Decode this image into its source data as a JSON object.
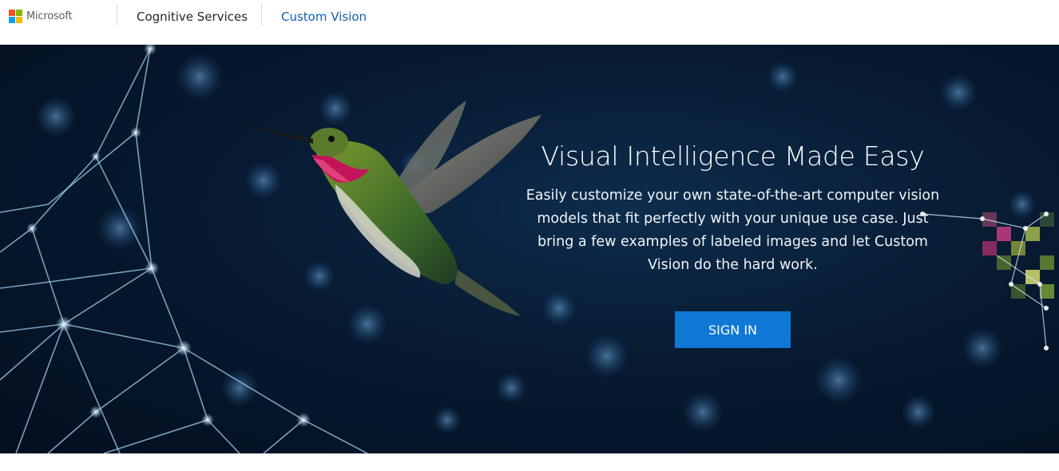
{
  "header": {
    "brand": "Microsoft",
    "brand_colors": [
      "#f25022",
      "#7fba00",
      "#00a4ef",
      "#ffb900"
    ],
    "nav": [
      {
        "label": "Cognitive Services"
      },
      {
        "label": "Custom Vision",
        "color": "#1160b7"
      }
    ]
  },
  "hero": {
    "title": "Visual Intelligence Made Easy",
    "description": "Easily customize your own state-of-the-art computer vision models that fit perfectly with your unique use case. Just bring a few examples of labeled images and let Custom Vision do the hard work.",
    "signin_label": "SIGN IN",
    "accent": "#0f78d4",
    "background_image": "hummingbird-network-icon"
  }
}
